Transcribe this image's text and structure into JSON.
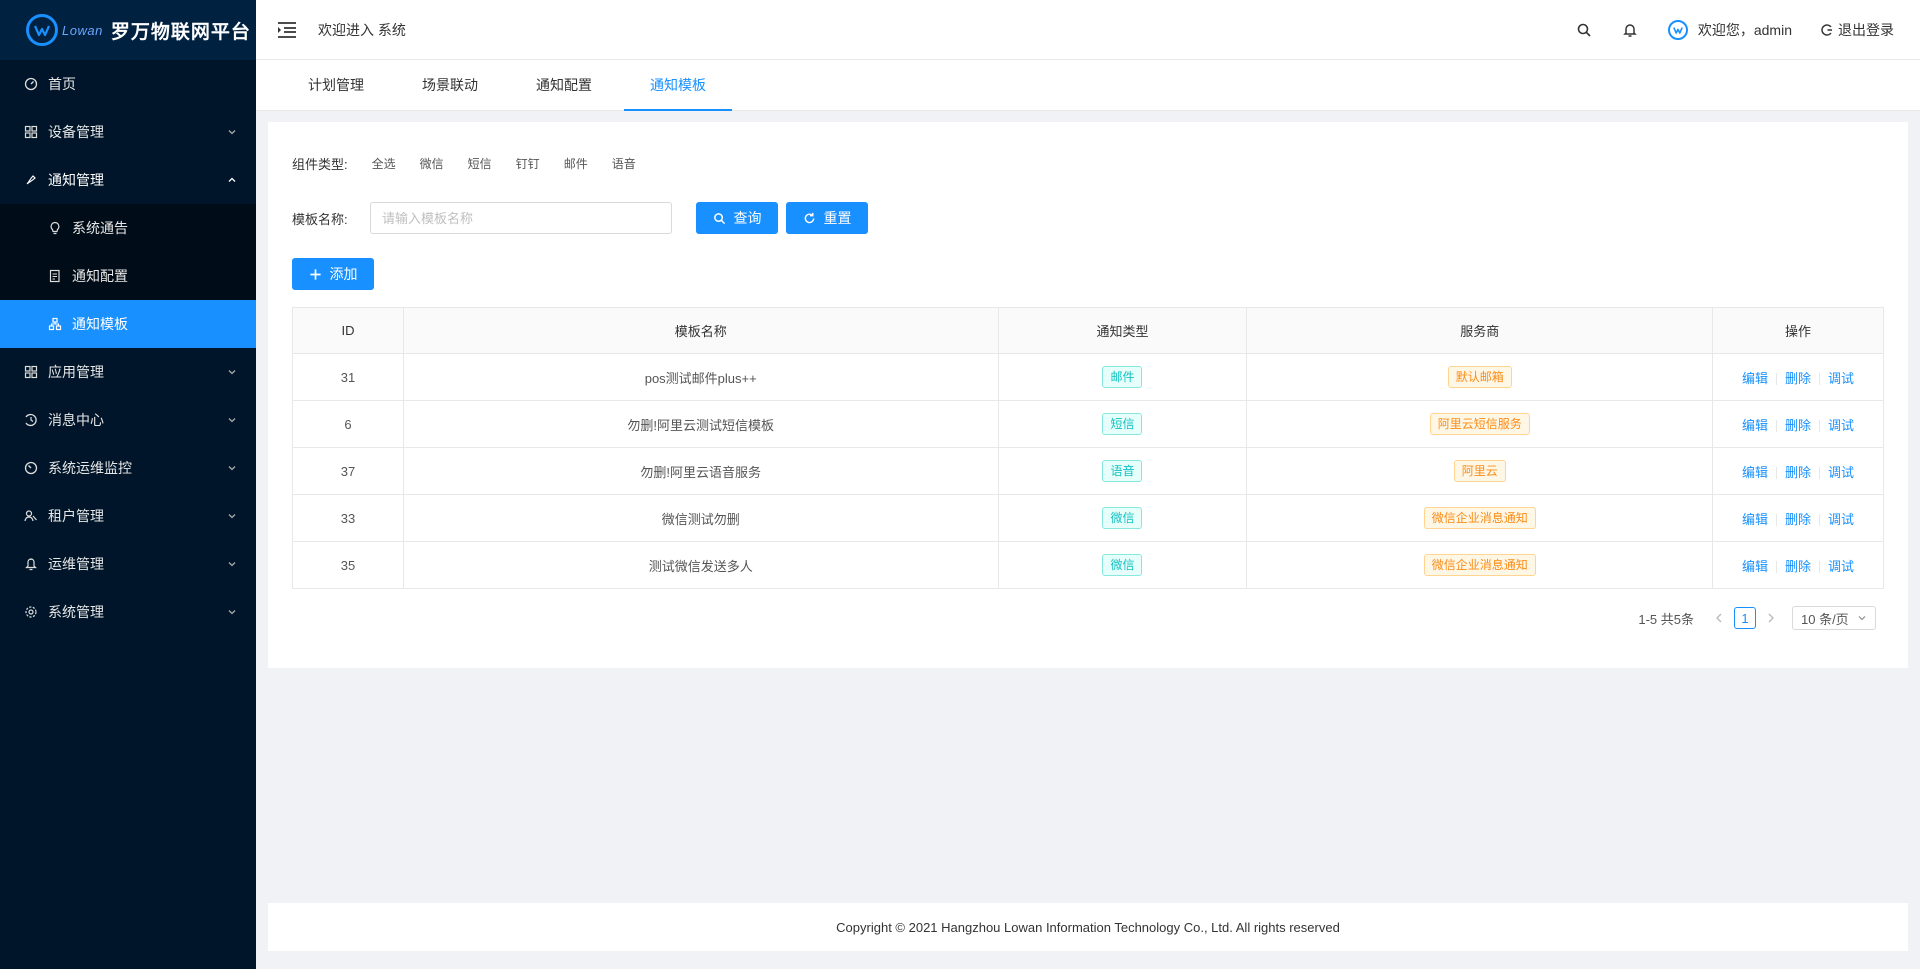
{
  "brand": {
    "logo_word": "Lowan",
    "title": "罗万物联网平台"
  },
  "header": {
    "welcome": "欢迎进入 系统",
    "user_greeting": "欢迎您，admin",
    "logout": "退出登录"
  },
  "sidebar": {
    "items": [
      {
        "label": "首页",
        "icon": "dashboard-icon"
      },
      {
        "label": "设备管理",
        "icon": "device-icon"
      },
      {
        "label": "通知管理",
        "icon": "notify-icon"
      },
      {
        "label": "应用管理",
        "icon": "app-icon"
      },
      {
        "label": "消息中心",
        "icon": "message-icon"
      },
      {
        "label": "系统运维监控",
        "icon": "monitor-icon"
      },
      {
        "label": "租户管理",
        "icon": "tenant-icon"
      },
      {
        "label": "运维管理",
        "icon": "ops-icon"
      },
      {
        "label": "系统管理",
        "icon": "gear-icon"
      }
    ],
    "sub_items": [
      {
        "label": "系统通告",
        "icon": "bulb-icon"
      },
      {
        "label": "通知配置",
        "icon": "doc-icon"
      },
      {
        "label": "通知模板",
        "icon": "template-icon"
      }
    ]
  },
  "tabs": [
    "计划管理",
    "场景联动",
    "通知配置",
    "通知模板"
  ],
  "filter": {
    "label": "组件类型:",
    "options": [
      "全选",
      "微信",
      "短信",
      "钉钉",
      "邮件",
      "语音"
    ]
  },
  "search": {
    "label": "模板名称:",
    "placeholder": "请输入模板名称",
    "query": "查询",
    "reset": "重置",
    "add": "添加"
  },
  "table": {
    "headers": [
      "ID",
      "模板名称",
      "通知类型",
      "服务商",
      "操作"
    ],
    "rows": [
      {
        "id": "31",
        "name": "pos测试邮件plus++",
        "type": "邮件",
        "provider": "默认邮箱"
      },
      {
        "id": "6",
        "name": "勿删!阿里云测试短信模板",
        "type": "短信",
        "provider": "阿里云短信服务"
      },
      {
        "id": "37",
        "name": "勿删!阿里云语音服务",
        "type": "语音",
        "provider": "阿里云"
      },
      {
        "id": "33",
        "name": "微信测试勿删",
        "type": "微信",
        "provider": "微信企业消息通知"
      },
      {
        "id": "35",
        "name": "测试微信发送多人",
        "type": "微信",
        "provider": "微信企业消息通知"
      }
    ],
    "ops": [
      "编辑",
      "删除",
      "调试"
    ]
  },
  "pager": {
    "total": "1-5 共5条",
    "page": "1",
    "size": "10 条/页"
  },
  "footer": {
    "copyright": "Copyright © 2021 Hangzhou Lowan Information Technology Co., Ltd. All rights reserved"
  },
  "colors": {
    "sidebar_bg": "#001529",
    "primary": "#1890ff",
    "tag_cyan": "#13c2c2",
    "tag_orange": "#fa8c16"
  }
}
